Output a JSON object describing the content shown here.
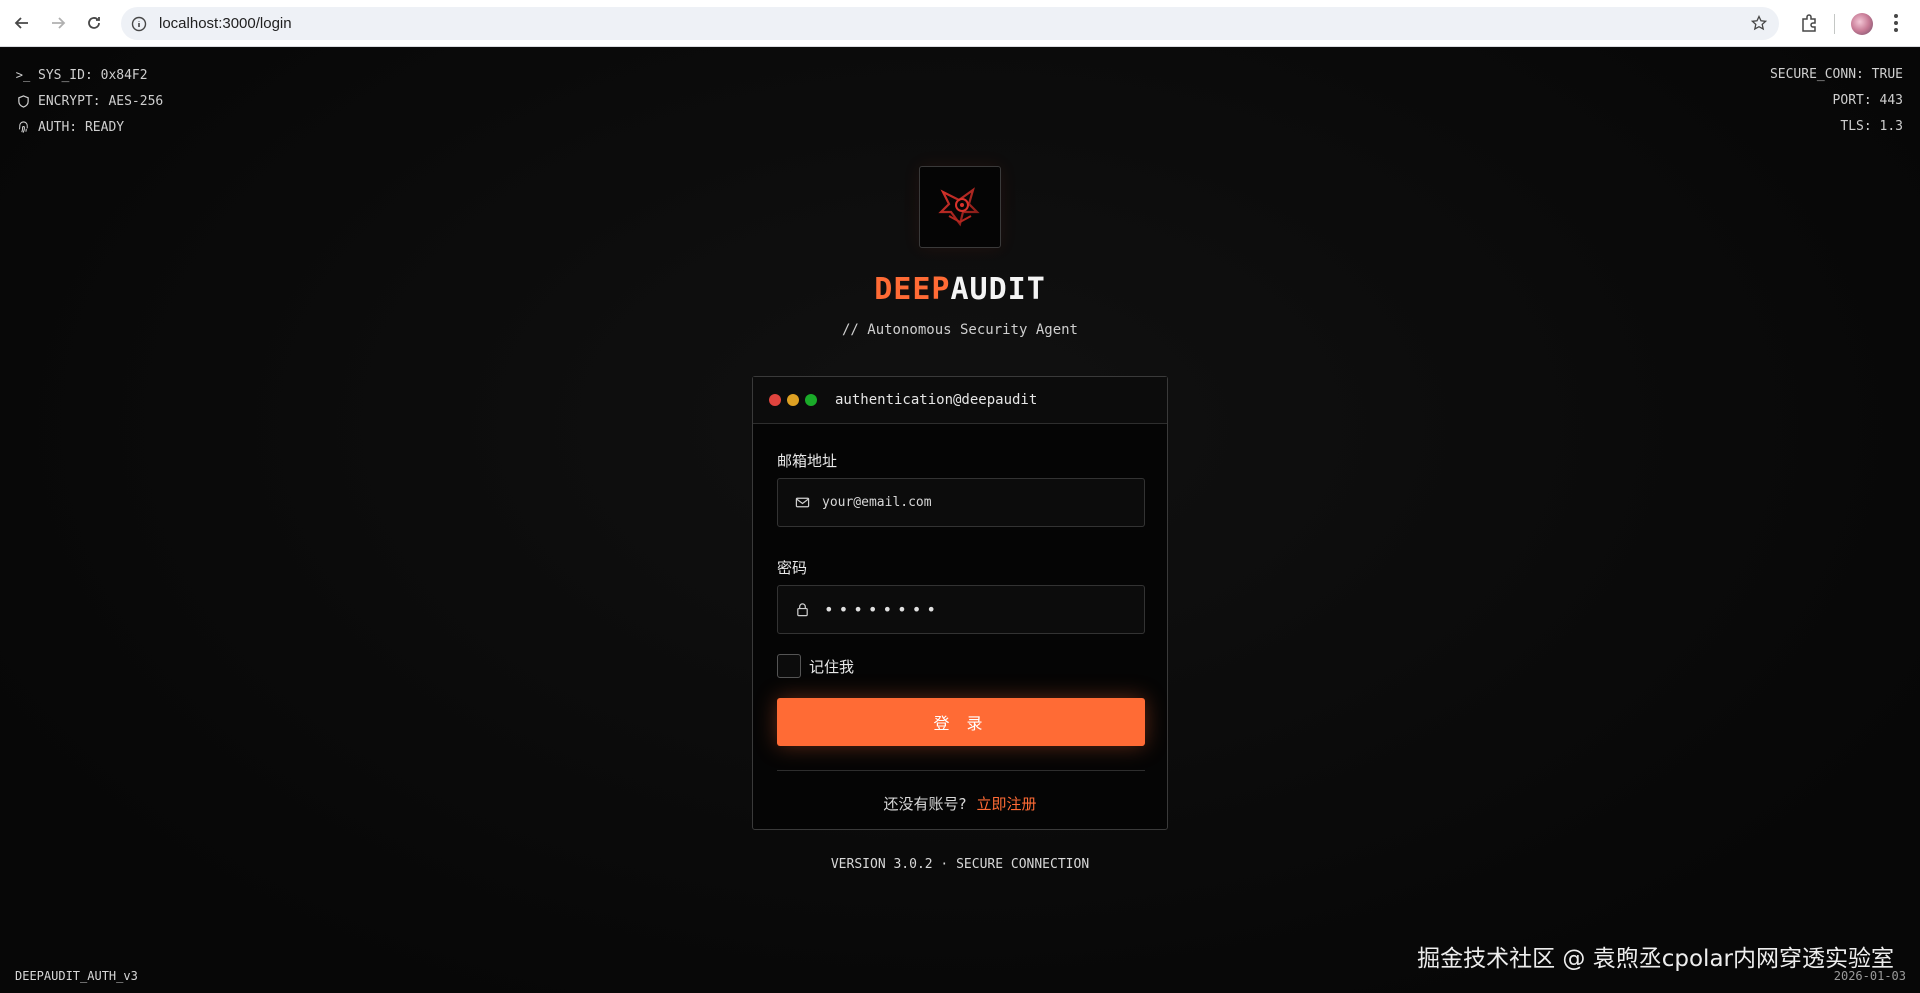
{
  "browser": {
    "url": "localhost:3000/login"
  },
  "sys_left": [
    {
      "icon": "terminal-icon",
      "text": "SYS_ID: 0x84F2"
    },
    {
      "icon": "shield-icon",
      "text": "ENCRYPT: AES-256"
    },
    {
      "icon": "fingerprint-icon",
      "text": "AUTH: READY"
    }
  ],
  "sys_right": [
    "SECURE_CONN: TRUE",
    "PORT: 443",
    "TLS: 1.3"
  ],
  "brand": {
    "part1": "DEEP",
    "part2": "AUDIT",
    "tagline": "// Autonomous Security Agent",
    "accent": "#ff6b35"
  },
  "card": {
    "title": "authentication@deepaudit",
    "window_dots": [
      "#e0443e",
      "#dea123",
      "#1aab29"
    ],
    "email_label": "邮箱地址",
    "email_placeholder": "your@email.com",
    "password_label": "密码",
    "password_mask": "••••••••",
    "remember_label": "记住我",
    "login_button": "登 录",
    "signup_question": "还没有账号?",
    "signup_link": "立即注册"
  },
  "version": "VERSION 3.0.2 · SECURE CONNECTION",
  "footer_left": "DEEPAUDIT_AUTH_v3",
  "footer_right": "2026-01-03",
  "watermark": "掘金技术社区 @ 袁煦丞cpolar内网穿透实验室"
}
